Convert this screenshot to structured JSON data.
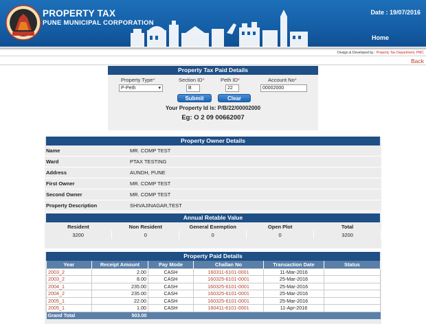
{
  "header": {
    "brand_title": "PROPERTY TAX",
    "brand_subtitle": "PUNE MUNICIPAL CORPORATION",
    "date": "Date : 19/07/2016",
    "home_label": "Home",
    "credit_label": "Design & Developed by :",
    "credit_org": "Property Tax Department, PMC",
    "back_label": "Back"
  },
  "search": {
    "title": "Property Tax Paid Details",
    "property_type_label": "Property Type",
    "property_type_value": "P-Peth",
    "section_label": "Section ID",
    "section_value": "B",
    "peth_label": "Peth ID",
    "peth_value": "22",
    "account_label": "Account No",
    "account_value": "00002000",
    "required_mark": "*",
    "submit_label": "Submit",
    "clear_label": "Clear",
    "property_id_line": "Your Property Id is: P/B/22/00002000",
    "example_line": "Eg: O 2 09 00662007"
  },
  "owner": {
    "title": "Property Owner Details",
    "rows": [
      {
        "label": "Name",
        "value": "MR. COMP TEST"
      },
      {
        "label": "Ward",
        "value": "PTAX TESTING"
      },
      {
        "label": "Address",
        "value": "AUNDH, PUNE"
      },
      {
        "label": "First Owner",
        "value": "MR. COMP TEST"
      },
      {
        "label": "Second Owner",
        "value": "MR. COMP TEST"
      },
      {
        "label": "Property Description",
        "value": "SHIVAJINAGAR,TEST"
      }
    ]
  },
  "arv": {
    "title": "Annual Retable Value",
    "headers": [
      "Resident",
      "Non Resident",
      "General Exemption",
      "Open Plot",
      "Total"
    ],
    "values": [
      "3200",
      "0",
      "0",
      "0",
      "3200"
    ]
  },
  "paid": {
    "title": "Property Paid Details",
    "headers": [
      "Year",
      "Receipt Amount",
      "Pay Mode",
      "Challan No",
      "Transaction Date",
      "Status"
    ],
    "rows": [
      {
        "year": "2003_2",
        "amount": "2.00",
        "mode": "CASH",
        "challan": "160311-6101-0001",
        "date": "11-Mar-2016",
        "status": ""
      },
      {
        "year": "2003_2",
        "amount": "8.00",
        "mode": "CASH",
        "challan": "160325-6101-0001",
        "date": "25-Mar-2016",
        "status": ""
      },
      {
        "year": "2004_1",
        "amount": "235.00",
        "mode": "CASH",
        "challan": "160325-6101-0001",
        "date": "25-Mar-2016",
        "status": ""
      },
      {
        "year": "2004_2",
        "amount": "235.00",
        "mode": "CASH",
        "challan": "160325-6101-0001",
        "date": "25-Mar-2016",
        "status": ""
      },
      {
        "year": "2005_1",
        "amount": "22.00",
        "mode": "CASH",
        "challan": "160325-6101-0001",
        "date": "25-Mar-2016",
        "status": ""
      },
      {
        "year": "2005_1",
        "amount": "1.00",
        "mode": "CASH",
        "challan": "160411-6101-0001",
        "date": "11-Apr-2016",
        "status": ""
      }
    ],
    "total_label": "Grand Total",
    "total_value": "503.00"
  },
  "colors": {
    "header_blue": "#1560a8",
    "panel_head": "#1e4f85",
    "table_head": "#5a7fa9",
    "link_red": "#b3402a"
  }
}
